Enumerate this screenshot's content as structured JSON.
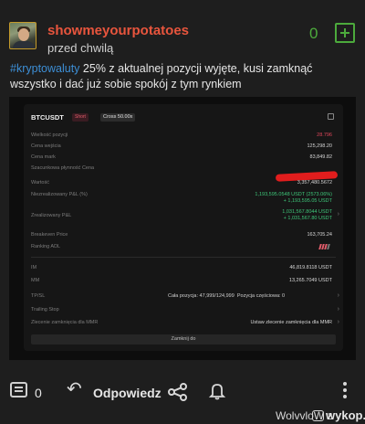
{
  "post": {
    "username": "showmeyourpotatoes",
    "time": "przed chwilą",
    "votes": "0",
    "tag": "#kryptowaluty",
    "text": " 25% z aktualnej pozycji wyjęte, kusi zamknąć wszystko i dać już sobie spokój z tym rynkiem"
  },
  "screenshot": {
    "symbol": "BTCUSDT",
    "badge_short": "Short",
    "badge_margin": "Cross 50.00x",
    "rows": [
      {
        "label": "Wielkość pozycji",
        "value": "28.796",
        "color": "red"
      },
      {
        "label": "Cena wejścia",
        "value": "125,298.20"
      },
      {
        "label": "Cena mark",
        "value": "83,849.82"
      },
      {
        "label": "Szacunkowa płynność Cena",
        "value": ""
      },
      {
        "label": "Wartość",
        "value": "3,357,480.5672"
      },
      {
        "label": "Niezrealizowany P&L (%)",
        "value": "1,193,595.0548 USDT (2573.06%)",
        "value2": "+ 1,193,595.05 USDT",
        "color": "green"
      },
      {
        "label": "Zrealizowany P&L",
        "value": "1,031,567.8044 USDT",
        "value2": "+ 1,031,567.80 USDT",
        "color": "green"
      },
      {
        "label": "Breakeven Price",
        "value": "163,705.24"
      },
      {
        "label": "Ranking ADL",
        "value": ""
      },
      {
        "label": "IM",
        "value": "46,819.8118 USDT"
      },
      {
        "label": "MM",
        "value": "13,265.7049 USDT"
      },
      {
        "label": "TP/SL",
        "value": ""
      },
      {
        "label": "Trailing Stop",
        "value": ""
      },
      {
        "label": "Zlecenie zamknięcia dla MMR",
        "value": "Ustaw zlecenie zamknięcia dla MMR"
      }
    ],
    "tpsl_text": "Cała pozycja: 47,999/124,999",
    "tpsl_partial": "Pozycja częściowa: 0",
    "close_button": "Zamknij do"
  },
  "actions": {
    "comments": "0",
    "reply": "Odpowiedz"
  },
  "watermark": {
    "author": "WolvvloW z",
    "site": "wykop.pl"
  },
  "colors": {
    "accent_green": "#4caa3c",
    "username": "#e8553d",
    "tag": "#3d8fd6",
    "background": "#1e1e1e"
  }
}
